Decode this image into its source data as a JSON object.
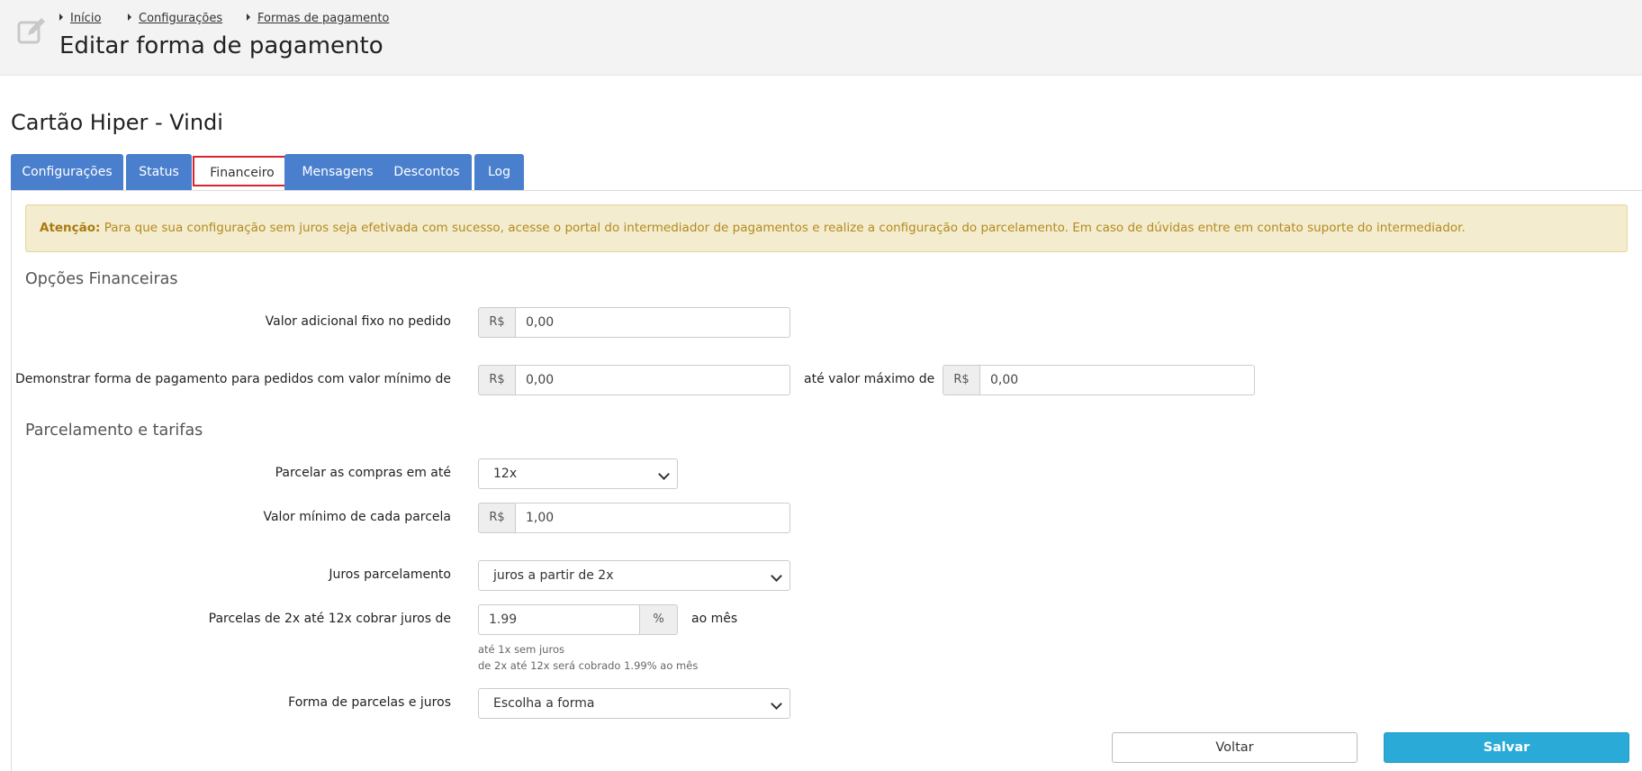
{
  "breadcrumb": {
    "items": [
      "Início",
      "Configurações",
      "Formas de pagamento"
    ]
  },
  "header": {
    "title": "Editar forma de pagamento"
  },
  "form": {
    "title": "Cartão Hiper - Vindi"
  },
  "tabs": [
    {
      "label": "Configurações"
    },
    {
      "label": "Status"
    },
    {
      "label": "Financeiro"
    },
    {
      "label": "Mensagens"
    },
    {
      "label": "Descontos"
    },
    {
      "label": "Log"
    }
  ],
  "active_tab": "Financeiro",
  "alert": {
    "strong": "Atenção:",
    "text": " Para que sua configuração sem juros seja efetivada com sucesso, acesse o portal do intermediador de pagamentos e realize a configuração do parcelamento. Em caso de dúvidas entre em contato suporte do intermediador."
  },
  "financial": {
    "section_title": "Opções Financeiras",
    "fixed_label": "Valor adicional fixo no pedido",
    "currency": "R$",
    "fixed_value": "0,00",
    "min_label": "Demonstrar forma de pagamento para pedidos com valor mínimo de",
    "min_value": "0,00",
    "max_label": "até valor máximo de",
    "max_value": "0,00"
  },
  "installments": {
    "section_title": "Parcelamento e tarifas",
    "max_label": "Parcelar as compras em até",
    "max_value": "12x",
    "min_parcel_label": "Valor mínimo de cada parcela",
    "min_parcel_value": "1,00",
    "interest_label": "Juros parcelamento",
    "interest_value": "juros a partir de 2x",
    "rate_label": "Parcelas de 2x até 12x cobrar juros de",
    "rate_value": "1.99",
    "rate_unit": "%",
    "rate_suffix": "ao mês",
    "help_line1": "até 1x sem juros",
    "help_line2": "de 2x até 12x será cobrado 1.99% ao mês",
    "form_label": "Forma de parcelas e juros",
    "form_value": "Escolha a forma"
  },
  "actions": {
    "back_label": "Voltar",
    "save_label": "Salvar"
  },
  "colors": {
    "tab_bg": "#4a7fce",
    "active_tab_border": "#d9232d",
    "alert_bg": "#f3ecce",
    "alert_text": "#b48a21",
    "save_bg": "#2aaad6"
  }
}
